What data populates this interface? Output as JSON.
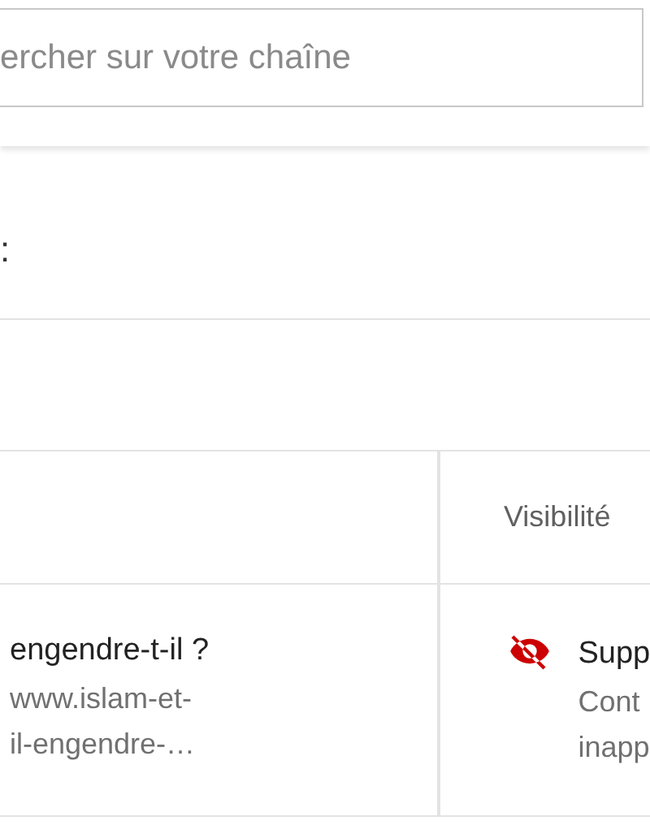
{
  "search": {
    "placeholder": "ercher sur votre chaîne"
  },
  "filter_label": ":",
  "table": {
    "columns": [
      "Visibilité"
    ],
    "rows": [
      {
        "title": "engendre-t-il ?",
        "url_lines": [
          "www.islam-et-",
          "il-engendre-…"
        ],
        "visibility": {
          "kind": "removed",
          "label": "Supp",
          "reason_lines": [
            "Cont",
            "inapp"
          ]
        }
      }
    ]
  }
}
